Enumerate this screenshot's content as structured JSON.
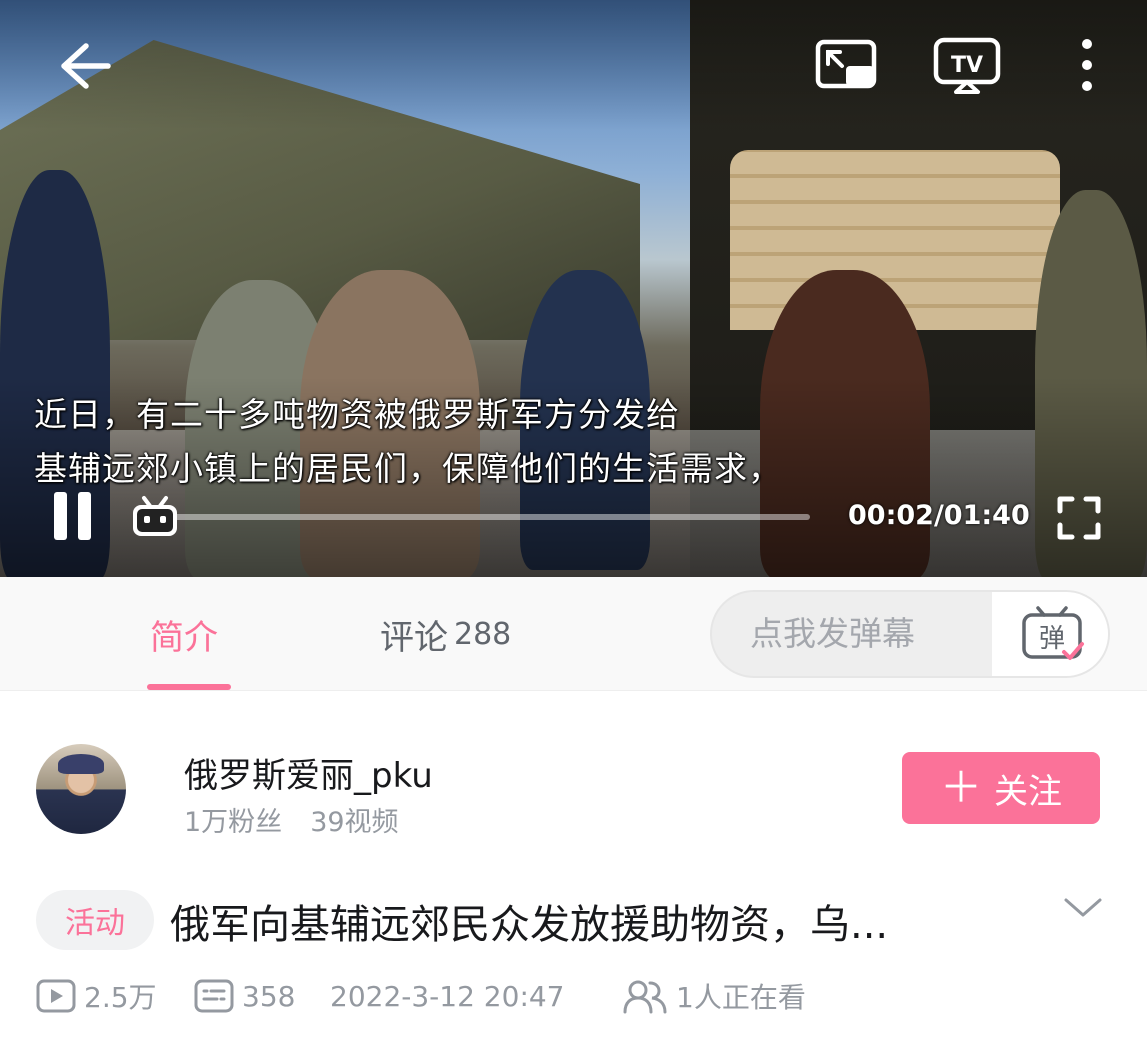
{
  "player": {
    "subtitle_line1": "近日，有二十多吨物资被俄罗斯军方分发给",
    "subtitle_line2": "基辅远郊小镇上的居民们，保障他们的生活需求，",
    "time": "00:02/01:40",
    "progress_fraction": 0.02,
    "icons": [
      "back-arrow-icon",
      "pip-icon",
      "cast-tv-icon",
      "more-vertical-icon",
      "pause-icon",
      "bilibili-tv-icon",
      "fullscreen-icon"
    ],
    "accent_color": "#fb7299"
  },
  "tabs": {
    "intro_label": "简介",
    "comment_label": "评论",
    "comment_count": "288",
    "active": "intro"
  },
  "danmaku": {
    "placeholder": "点我发弹幕",
    "toggle_glyph": "弹"
  },
  "uploader": {
    "name": "俄罗斯爱丽_pku",
    "followers": "1万粉丝",
    "videos": "39视频",
    "follow_label": "关注",
    "follow_plus": "＋"
  },
  "video": {
    "badge": "活动",
    "title": "俄军向基辅远郊民众发放援助物资，乌...",
    "plays": "2.5万",
    "danmaku_count": "358",
    "publish_time": "2022-3-12 20:47",
    "watching": "1人正在看"
  }
}
